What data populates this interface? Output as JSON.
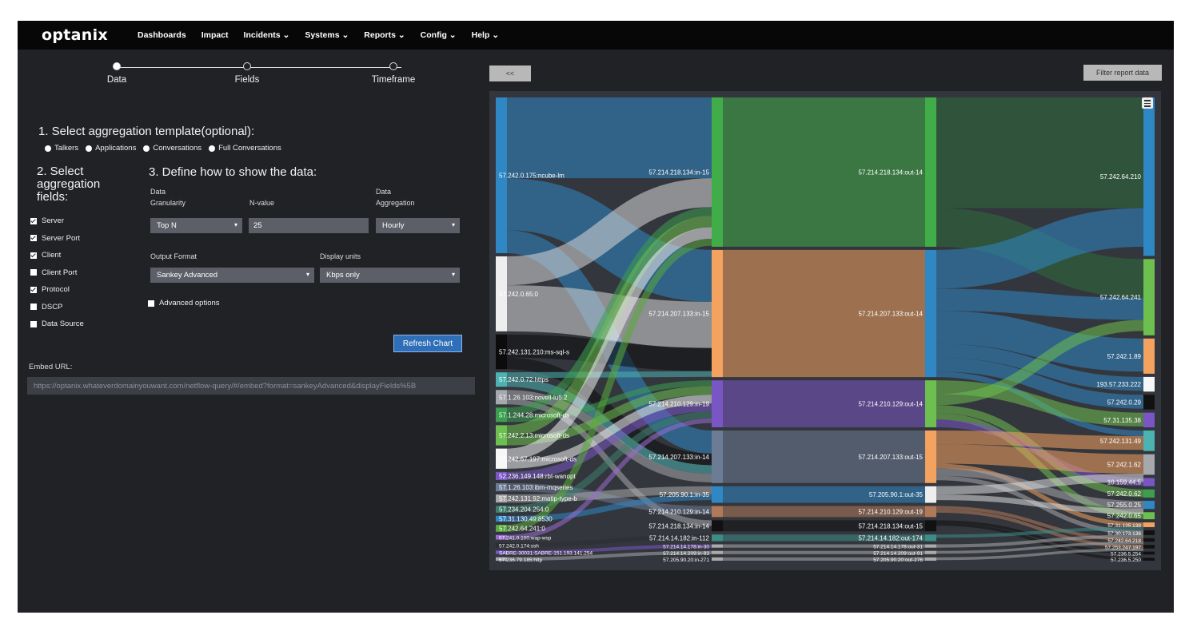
{
  "app": {
    "logo": "optanix"
  },
  "nav": [
    "Dashboards",
    "Impact",
    "Incidents ⌄",
    "Systems ⌄",
    "Reports ⌄",
    "Config ⌄",
    "Help ⌄"
  ],
  "wizard": {
    "steps": [
      "Data",
      "Fields",
      "Timeframe"
    ],
    "active": 0
  },
  "step1": {
    "heading": "1. Select aggregation template(optional):",
    "options": [
      "Talkers",
      "Applications",
      "Conversations",
      "Full Conversations"
    ]
  },
  "step2": {
    "heading": "2. Select aggregation fields:",
    "fields": [
      {
        "label": "Server",
        "checked": true
      },
      {
        "label": "Server Port",
        "checked": true
      },
      {
        "label": "Client",
        "checked": true
      },
      {
        "label": "Client Port",
        "checked": false
      },
      {
        "label": "Protocol",
        "checked": true
      },
      {
        "label": "DSCP",
        "checked": false
      },
      {
        "label": "Data Source",
        "checked": false
      }
    ]
  },
  "step3": {
    "heading": "3. Define how to show the data:",
    "granularity_label_1": "Data",
    "granularity_label_2": "Granularity",
    "granularity_value": "Top N",
    "nvalue_label": "N-value",
    "nvalue_value": "25",
    "aggregation_label_1": "Data",
    "aggregation_label_2": "Aggregation",
    "aggregation_value": "Hourly",
    "output_label": "Output Format",
    "output_value": "Sankey Advanced",
    "units_label": "Display units",
    "units_value": "Kbps only",
    "advanced_label": "Advanced options",
    "refresh_label": "Refresh Chart"
  },
  "embed": {
    "label": "Embed URL:",
    "url": "https://optanix.whateverdomainyouwant.com/netflow-query/#/embed?format=sankeyAdvanced&displayFields%5B"
  },
  "chart_toolbar": {
    "back_label": "<<",
    "filter_label": "Filter report data",
    "menu_icon": "hamburger-menu-icon"
  },
  "chart_data": {
    "type": "sankey",
    "columns": [
      [
        {
          "label": "57.242.0.175:ncube-lm",
          "color": "#2f87c4",
          "value": 27
        },
        {
          "label": "57.242.0.65:0",
          "color": "#eeeeee",
          "value": 13
        },
        {
          "label": "57.242.131.210:ms-sql-s",
          "color": "#0c0c0c",
          "value": 6
        },
        {
          "label": "57.242.0.72:https",
          "color": "#4cb3b0",
          "value": 2.5
        },
        {
          "label": "57.1.26.103:novell-lu6.2",
          "color": "#a5a8ad",
          "value": 2.5
        },
        {
          "label": "57.1.244.28:microsoft-ds",
          "color": "#3c9e4e",
          "value": 2.5
        },
        {
          "label": "57.242.2.13:microsoft-ds",
          "color": "#6dbf4f",
          "value": 3.5
        },
        {
          "label": "57.242.67.197:microsoft-ds",
          "color": "#f7f7f7",
          "value": 3.5
        },
        {
          "label": "52.236.149.148:rbt-wanopt",
          "color": "#7a56c4",
          "value": 1.4
        },
        {
          "label": "57.1.26.103:ibm-mqseries",
          "color": "#6d7c95",
          "value": 1.4
        },
        {
          "label": "57.242.131.92:matip-type-b",
          "color": "#aaaaaa",
          "value": 1.4
        },
        {
          "label": "57.234.204.254:0",
          "color": "#3e7f6d",
          "value": 1.2
        },
        {
          "label": "57.31.130.49:8530",
          "color": "#2f87c4",
          "value": 1
        },
        {
          "label": "57.242.64.241:0",
          "color": "#5aaa3d",
          "value": 1.2
        },
        {
          "label": "57.241.0.100:wap-wsp",
          "color": "#9b6bd4",
          "value": 0.8
        },
        {
          "label": "57.242.0.174:ssh",
          "color": "#2b2d31",
          "value": 0.8
        },
        {
          "label": "SABRE-30031:SABRE-151.193.141.254",
          "color": "#7a56c4",
          "value": 0.6
        },
        {
          "label": "57.236.79.185:http",
          "color": "#a5a8ad",
          "value": 0.6
        }
      ],
      [
        {
          "label": "57.214.218.134:in-15",
          "color": "#41ad48",
          "value": 27
        },
        {
          "label": "57.214.207.133:in-15",
          "color": "#f4a260",
          "value": 23
        },
        {
          "label": "57.214.210.129:in-19",
          "color": "#7a56c4",
          "value": 8.5
        },
        {
          "label": "57.214.207.133:in-14",
          "color": "#6d7c95",
          "value": 9.5
        },
        {
          "label": "57.205.90.1:in-35",
          "color": "#2f87c4",
          "value": 3
        },
        {
          "label": "57.214.210.129:in-14",
          "color": "#b07a5a",
          "value": 2
        },
        {
          "label": "57.214.218.134:in-14",
          "color": "#111111",
          "value": 2
        },
        {
          "label": "57.214.14.182:in-112",
          "color": "#3c8d87",
          "value": 1.2
        },
        {
          "label": "57.214.14.178:in-30",
          "color": "#aaaaaa",
          "value": 0.6
        },
        {
          "label": "57.214.14.209:in-93",
          "color": "#aaaaaa",
          "value": 0.6
        },
        {
          "label": "57.205.90.20:in-271",
          "color": "#aaaaaa",
          "value": 0.6
        }
      ],
      [
        {
          "label": "57.214.218.134:out-14",
          "color": "#41ad48",
          "value": 27
        },
        {
          "label": "57.214.207.133:out-14",
          "color": "#2f87c4",
          "value": 23
        },
        {
          "label": "57.214.210.129:out-14",
          "color": "#6dbf4f",
          "value": 8.5
        },
        {
          "label": "57.214.207.133:out-15",
          "color": "#f4a260",
          "value": 9.5
        },
        {
          "label": "57.205.90.1:out-35",
          "color": "#eeeeee",
          "value": 3
        },
        {
          "label": "57.214.210.129:out-19",
          "color": "#b07a5a",
          "value": 2
        },
        {
          "label": "57.214.218.134:out-15",
          "color": "#111111",
          "value": 2
        },
        {
          "label": "57.214.14.182:out-174",
          "color": "#3c8d87",
          "value": 1.2
        },
        {
          "label": "57.214.14.178:out-31",
          "color": "#aaaaaa",
          "value": 0.6
        },
        {
          "label": "57.214.14.209:out-91",
          "color": "#aaaaaa",
          "value": 0.6
        },
        {
          "label": "57.205.90.20:out-276",
          "color": "#aaaaaa",
          "value": 0.6
        }
      ],
      [
        {
          "label": "57.242.64.210",
          "color": "#2f87c4",
          "value": 27
        },
        {
          "label": "57.242.64.241",
          "color": "#6dbf4f",
          "value": 13
        },
        {
          "label": "57.242.1.89",
          "color": "#f4a260",
          "value": 6
        },
        {
          "label": "193.57.233.222",
          "color": "#f7f7f7",
          "value": 2.5
        },
        {
          "label": "57.242.0.29",
          "color": "#111111",
          "value": 2.5
        },
        {
          "label": "57.31.135.38",
          "color": "#7a56c4",
          "value": 2.5
        },
        {
          "label": "57.242.131.49",
          "color": "#4cb3b0",
          "value": 3.5
        },
        {
          "label": "57.242.1.62",
          "color": "#a5a8ad",
          "value": 3.5
        },
        {
          "label": "10.159.44.5",
          "color": "#7a56c4",
          "value": 1.4
        },
        {
          "label": "57.242.0.62",
          "color": "#3c9e4e",
          "value": 1.4
        },
        {
          "label": "57.255.0.25",
          "color": "#2f87c4",
          "value": 1.4
        },
        {
          "label": "57.242.0.65",
          "color": "#6dbf4f",
          "value": 1.2
        },
        {
          "label": "57.31.135.138",
          "color": "#f4a260",
          "value": 0.8
        },
        {
          "label": "57.30.173.136",
          "color": "#111111",
          "value": 0.8
        },
        {
          "label": "57.242.64.218",
          "color": "#111111",
          "value": 0.6
        },
        {
          "label": "57.253.247.197",
          "color": "#111111",
          "value": 0.6
        },
        {
          "label": "57.236.5.254",
          "color": "#111111",
          "value": 0.5
        },
        {
          "label": "57.236.5.250",
          "color": "#111111",
          "value": 0.5
        }
      ]
    ],
    "links": [
      [
        0,
        0,
        0,
        14,
        "#2f87c4"
      ],
      [
        0,
        0,
        1,
        9,
        "#2f87c4"
      ],
      [
        0,
        0,
        3,
        4,
        "#2f87c4"
      ],
      [
        0,
        1,
        0,
        5,
        "#d8d8d8"
      ],
      [
        0,
        1,
        1,
        8,
        "#d8d8d8"
      ],
      [
        0,
        2,
        1,
        4,
        "#0c0c0c"
      ],
      [
        0,
        2,
        3,
        2,
        "#0c0c0c"
      ],
      [
        0,
        3,
        1,
        1,
        "#4cb3b0"
      ],
      [
        0,
        3,
        3,
        1.5,
        "#4cb3b0"
      ],
      [
        0,
        4,
        3,
        1.5,
        "#a5a8ad"
      ],
      [
        0,
        4,
        6,
        1,
        "#a5a8ad"
      ],
      [
        0,
        5,
        0,
        1.5,
        "#3c9e4e"
      ],
      [
        0,
        5,
        2,
        1,
        "#3c9e4e"
      ],
      [
        0,
        6,
        0,
        2,
        "#6dbf4f"
      ],
      [
        0,
        6,
        2,
        1.5,
        "#6dbf4f"
      ],
      [
        0,
        7,
        0,
        2,
        "#f0f0f0"
      ],
      [
        0,
        7,
        2,
        1.5,
        "#f0f0f0"
      ],
      [
        0,
        8,
        2,
        1.4,
        "#7a56c4"
      ],
      [
        0,
        9,
        5,
        1.4,
        "#6d7c95"
      ],
      [
        0,
        10,
        4,
        1.4,
        "#aaaaaa"
      ],
      [
        0,
        11,
        2,
        1.2,
        "#3e7f6d"
      ],
      [
        0,
        12,
        4,
        1,
        "#2f87c4"
      ],
      [
        0,
        13,
        0,
        1.2,
        "#5aaa3d"
      ],
      [
        0,
        14,
        2,
        0.8,
        "#9b6bd4"
      ],
      [
        0,
        15,
        7,
        0.8,
        "#2b2d31"
      ],
      [
        0,
        16,
        8,
        0.6,
        "#7a56c4"
      ],
      [
        0,
        17,
        9,
        0.6,
        "#a5a8ad"
      ],
      [
        1,
        0,
        0,
        27,
        "#41ad48"
      ],
      [
        1,
        1,
        1,
        23,
        "#f4a260"
      ],
      [
        1,
        2,
        2,
        8.5,
        "#7a56c4"
      ],
      [
        1,
        3,
        3,
        9.5,
        "#6d7c95"
      ],
      [
        1,
        4,
        4,
        3,
        "#2f87c4"
      ],
      [
        1,
        5,
        5,
        2,
        "#b07a5a"
      ],
      [
        1,
        6,
        6,
        2,
        "#111111"
      ],
      [
        1,
        7,
        7,
        1.2,
        "#3c8d87"
      ],
      [
        1,
        8,
        8,
        0.6,
        "#aaaaaa"
      ],
      [
        1,
        9,
        9,
        0.6,
        "#aaaaaa"
      ],
      [
        1,
        10,
        10,
        0.6,
        "#aaaaaa"
      ],
      [
        2,
        0,
        0,
        20,
        "#2e6b3d"
      ],
      [
        2,
        0,
        1,
        7,
        "#2e6b3d"
      ],
      [
        2,
        1,
        0,
        7,
        "#2f87c4"
      ],
      [
        2,
        1,
        1,
        4,
        "#2f87c4"
      ],
      [
        2,
        1,
        2,
        6,
        "#2f87c4"
      ],
      [
        2,
        1,
        3,
        2.5,
        "#2f87c4"
      ],
      [
        2,
        1,
        4,
        2.5,
        "#2f87c4"
      ],
      [
        2,
        1,
        6,
        1,
        "#2f87c4"
      ],
      [
        2,
        2,
        5,
        2.5,
        "#6dbf4f"
      ],
      [
        2,
        2,
        1,
        2,
        "#6dbf4f"
      ],
      [
        2,
        2,
        9,
        1.4,
        "#6dbf4f"
      ],
      [
        2,
        2,
        11,
        1.2,
        "#6dbf4f"
      ],
      [
        2,
        2,
        8,
        1.4,
        "#7a56c4"
      ],
      [
        2,
        3,
        6,
        2.5,
        "#f4a260"
      ],
      [
        2,
        3,
        7,
        3.5,
        "#f4a260"
      ],
      [
        2,
        3,
        12,
        0.8,
        "#f4a260"
      ],
      [
        2,
        3,
        10,
        1.4,
        "#a5a8ad"
      ],
      [
        2,
        3,
        13,
        0.8,
        "#a5a8ad"
      ],
      [
        2,
        4,
        7,
        1.5,
        "#dddddd"
      ],
      [
        2,
        4,
        10,
        1,
        "#dddddd"
      ],
      [
        2,
        5,
        14,
        0.6,
        "#b07a5a"
      ],
      [
        2,
        5,
        15,
        0.6,
        "#b07a5a"
      ],
      [
        2,
        6,
        16,
        0.5,
        "#111111"
      ],
      [
        2,
        6,
        17,
        0.5,
        "#111111"
      ],
      [
        2,
        7,
        12,
        0.6,
        "#3c8d87"
      ],
      [
        2,
        8,
        13,
        0.6,
        "#aaaaaa"
      ],
      [
        2,
        9,
        14,
        0.5,
        "#aaaaaa"
      ],
      [
        2,
        10,
        15,
        0.5,
        "#aaaaaa"
      ]
    ]
  }
}
